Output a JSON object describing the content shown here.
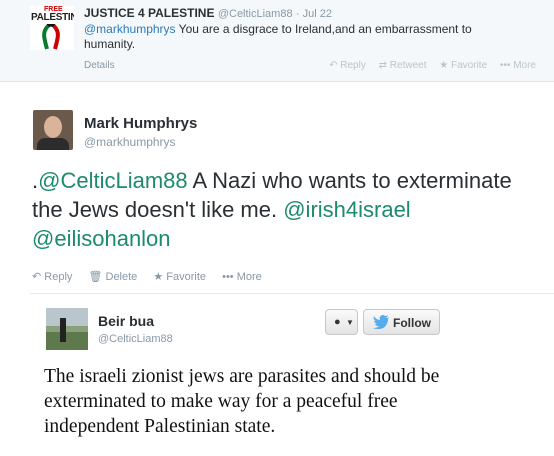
{
  "reply_tweet": {
    "avatar_top_text": "FREE",
    "avatar_main_text": "PALESTINE",
    "name": "JUSTICE 4 PALESTINE",
    "handle": "@CelticLiam88",
    "date": "· Jul 22",
    "mention": "@markhumphrys",
    "text": " You are a disgrace to Ireland,and an embarrassment to humanity.",
    "details_label": "Details",
    "actions": {
      "reply": "Reply",
      "retweet": "Retweet",
      "favorite": "Favorite",
      "more": "More"
    }
  },
  "main_tweet": {
    "name": "Mark Humphrys",
    "handle": "@markhumphrys",
    "text_prefix": ".",
    "link_1": "@CelticLiam88",
    "text_body": " A Nazi who wants to exterminate the Jews doesn't like me. ",
    "link_2": "@irish4israel",
    "link_3": "@eilisohanlon",
    "actions": {
      "reply": "Reply",
      "delete": "Delete",
      "favorite": "Favorite",
      "more": "More"
    }
  },
  "embedded_tweet": {
    "name": "Beir bua",
    "handle": "@CelticLiam88",
    "follow_label": "Follow",
    "text": "The israeli zionist jews are parasites and should be exterminated to make way for a peaceful free independent Palestinian state."
  },
  "colors": {
    "link_green": "#1c8a6e",
    "mention_blue": "#2b7bb9",
    "twitter_blue": "#55acee"
  }
}
